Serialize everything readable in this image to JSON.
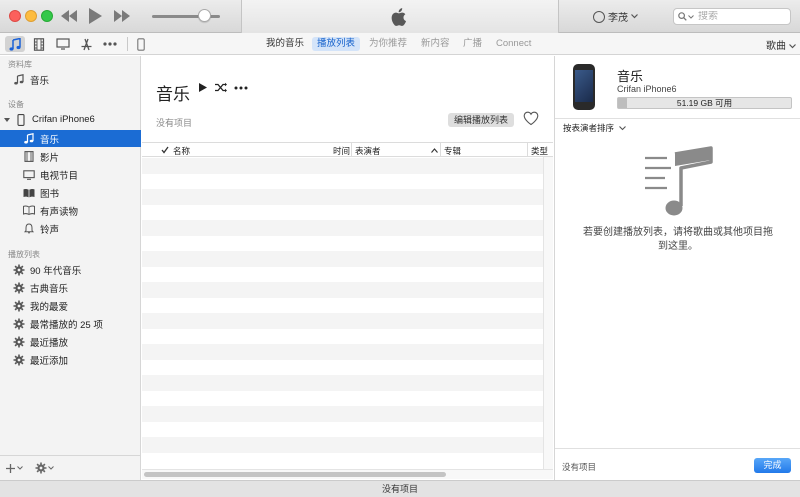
{
  "titlebar": {
    "user_name": "李茂",
    "search_placeholder": "搜索",
    "icons": [
      "rewind-icon",
      "play-icon",
      "fast-forward-icon",
      "apple-logo-icon",
      "user-icon",
      "search-icon"
    ]
  },
  "toolbar": {
    "tabs": [
      "我的音乐",
      "播放列表",
      "为你推荐",
      "新内容",
      "广播",
      "Connect"
    ],
    "selected_tab": "播放列表",
    "sort_label": "歌曲"
  },
  "sidebar": {
    "library_header": "资料库",
    "library_items": [
      "音乐"
    ],
    "devices_header": "设备",
    "device_name": "Crifan iPhone6",
    "device_items": [
      "音乐",
      "影片",
      "电视节目",
      "图书",
      "有声读物",
      "铃声"
    ],
    "playlists_header": "播放列表",
    "playlists": [
      "90 年代音乐",
      "古典音乐",
      "我的最爱",
      "最常播放的 25 项",
      "最近播放",
      "最近添加"
    ]
  },
  "main": {
    "title": "音乐",
    "no_items": "没有项目",
    "edit_playlist": "编辑播放列表",
    "columns": {
      "name": "名称",
      "time": "时间",
      "artist": "表演者",
      "album": "专辑",
      "genre": "类型"
    }
  },
  "rpanel": {
    "device_name": "音乐",
    "device_model": "Crifan iPhone6",
    "storage": "51.19 GB 可用",
    "sort_by": "按表演者排序",
    "empty_message": "若要创建播放列表，请将歌曲或其他项目拖到这里。",
    "footer_text": "没有项目",
    "done": "完成"
  },
  "statusbar": {
    "text": "没有项目"
  },
  "colors": {
    "accent": "#1b6cd4",
    "done_button": "#2279ea"
  }
}
